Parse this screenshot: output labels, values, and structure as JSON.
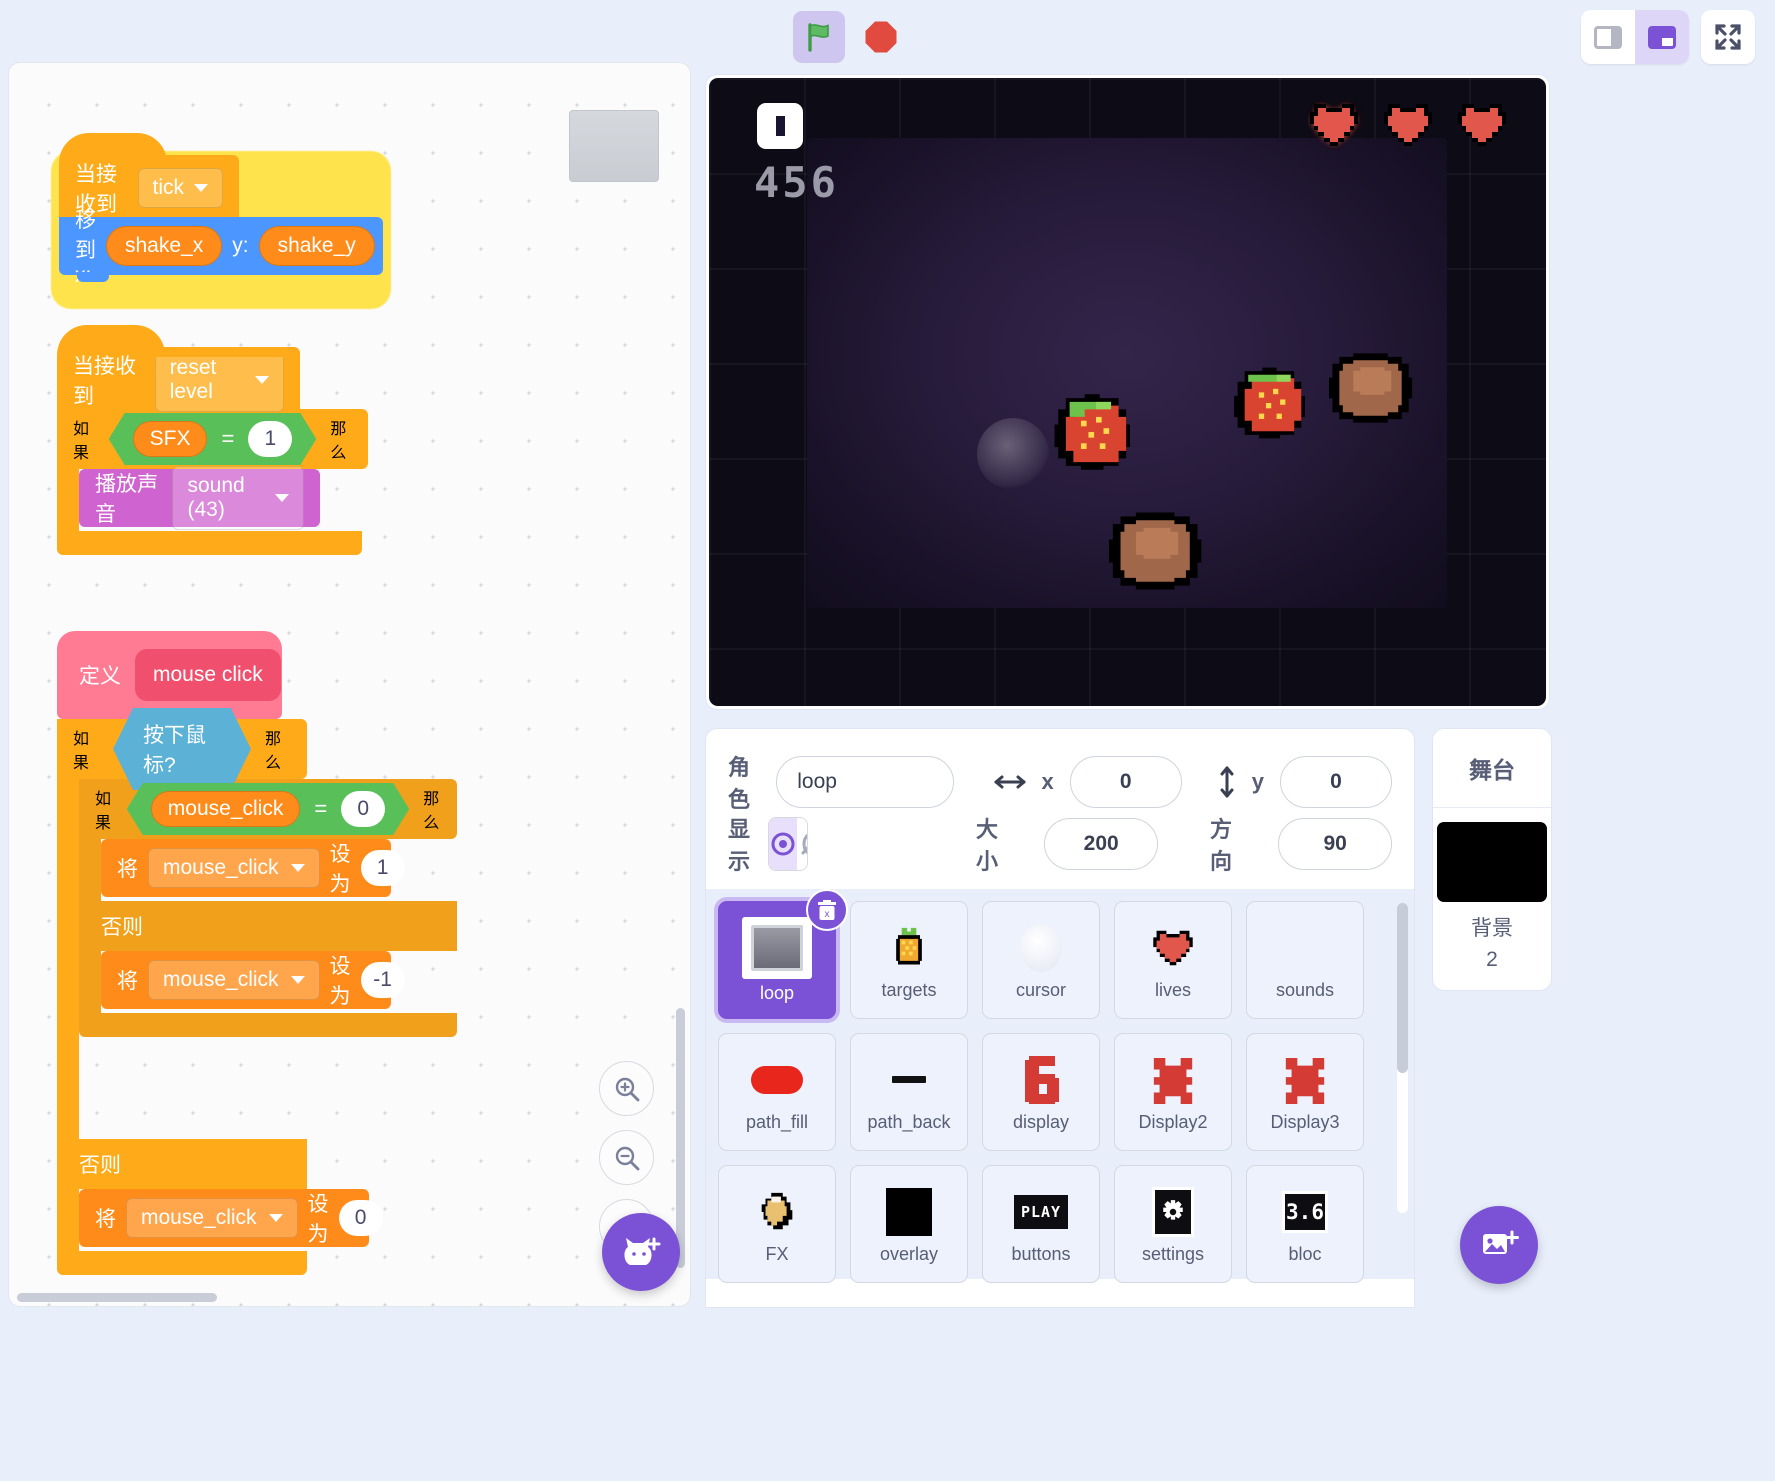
{
  "toolbar": {
    "green_flag": "green-flag",
    "stop": "stop-sign",
    "layout_small": "small-stage-layout",
    "layout_large": "large-stage-layout",
    "fullscreen": "fullscreen"
  },
  "stage": {
    "score": "456",
    "lives_count": 3,
    "pause_icon": "pause"
  },
  "scripts": [
    {
      "id": "script-tick",
      "highlighted": true,
      "hat": {
        "label": "当接收到",
        "dropdown": "tick"
      },
      "body": [
        {
          "type": "motion",
          "label": "移到 x:",
          "x_var": "shake_x",
          "label2": "y:",
          "y_var": "shake_y"
        }
      ]
    },
    {
      "id": "script-reset-level",
      "hat": {
        "label": "当接收到",
        "dropdown": "reset level"
      },
      "if_label": "如果",
      "then_label": "那么",
      "condition": {
        "left": "SFX",
        "op": "=",
        "right": "1"
      },
      "inner": {
        "label": "播放声音",
        "dropdown": "sound (43)"
      }
    },
    {
      "id": "script-mouse-click",
      "define_label": "定义",
      "define_name": "mouse click",
      "outer_if": "如果",
      "outer_then": "那么",
      "outer_cond": "按下鼠标?",
      "inner_if": "如果",
      "inner_then": "那么",
      "inner_cond": {
        "left": "mouse_click",
        "op": "=",
        "right": "0"
      },
      "set_label": "将",
      "to_label": "设为",
      "inner_if_var": "mouse_click",
      "inner_if_val": "1",
      "inner_else_label": "否则",
      "inner_else_var": "mouse_click",
      "inner_else_val": "-1",
      "outer_else_label": "否则",
      "outer_else_var": "mouse_click",
      "outer_else_val": "0"
    }
  ],
  "sprite_info": {
    "name_label": "角色",
    "name_value": "loop",
    "x_label": "x",
    "x_value": "0",
    "y_label": "y",
    "y_value": "0",
    "show_label": "显示",
    "size_label": "大小",
    "size_value": "200",
    "direction_label": "方向",
    "direction_value": "90",
    "visible": true
  },
  "sprites": [
    {
      "name": "loop",
      "icon": "dark-room-thumbnail",
      "selected": true
    },
    {
      "name": "targets",
      "icon": "pineapple-pixel"
    },
    {
      "name": "cursor",
      "icon": "white-orb"
    },
    {
      "name": "lives",
      "icon": "pixel-heart"
    },
    {
      "name": "sounds",
      "icon": "blank"
    },
    {
      "name": "path_fill",
      "icon": "red-rounded-bar"
    },
    {
      "name": "path_back",
      "icon": "black-dash"
    },
    {
      "name": "display",
      "icon": "digit-six"
    },
    {
      "name": "Display2",
      "icon": "red-x-glyph"
    },
    {
      "name": "Display3",
      "icon": "red-x-glyph"
    },
    {
      "name": "FX",
      "icon": "pixel-shell"
    },
    {
      "name": "overlay",
      "icon": "black-square"
    },
    {
      "name": "buttons",
      "icon": "play-badge"
    },
    {
      "name": "settings",
      "icon": "gear-badge"
    },
    {
      "name": "bloc",
      "icon": "number-badge"
    }
  ],
  "stage_panel": {
    "title": "舞台",
    "backdrop_label": "背景",
    "backdrop_count": "2"
  },
  "zoom_controls": {
    "zoom_in": "+",
    "zoom_out": "−",
    "zoom_reset": "="
  },
  "colors": {
    "accent": "#7b52d6",
    "events": "#ffab19",
    "motion": "#4c97ff",
    "sound": "#cf63cf",
    "variables": "#ff8c1a",
    "operators": "#59c059",
    "sensing": "#5cb1d6",
    "mypblocks": "#ff6680",
    "highlight": "#ffe34d"
  }
}
